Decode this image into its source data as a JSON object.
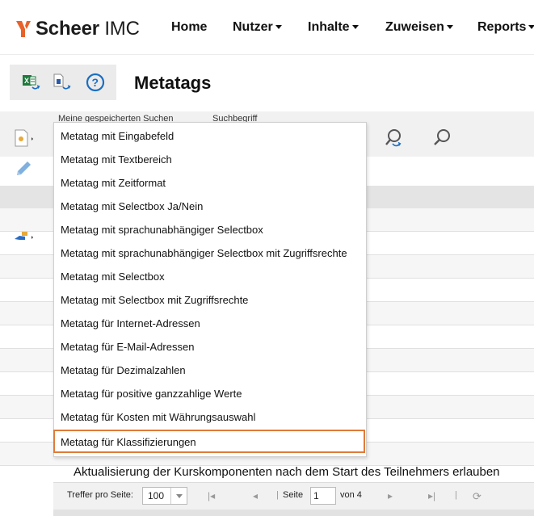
{
  "app": {
    "logo_text_bold": "Scheer",
    "logo_text_rest": " IMC",
    "brand_color": "#e8622a"
  },
  "nav": {
    "items": [
      {
        "label": "Home",
        "dropdown": false
      },
      {
        "label": "Nutzer",
        "dropdown": true
      },
      {
        "label": "Inhalte",
        "dropdown": true
      },
      {
        "label": "Zuweisen",
        "dropdown": true
      },
      {
        "label": "Reports",
        "dropdown": true
      }
    ]
  },
  "header": {
    "title": "Metatags",
    "icons": [
      "excel-export-icon",
      "document-export-icon",
      "help-icon"
    ]
  },
  "search": {
    "saved_searches_label": "Meine gespeicherten Suchen",
    "search_term_label": "Suchbegriff"
  },
  "toolbar": {
    "icons": [
      "new-document-icon",
      "edit-icon",
      "delete-icon",
      "assign-icon",
      "edit-permissions-icon"
    ]
  },
  "menu": {
    "items": [
      "Metatag mit Eingabefeld",
      "Metatag mit Textbereich",
      "Metatag mit Zeitformat",
      "Metatag mit Selectbox Ja/Nein",
      "Metatag mit sprachunabhängiger Selectbox",
      "Metatag mit sprachunabhängiger Selectbox mit Zugriffsrechte",
      "Metatag mit Selectbox",
      "Metatag mit Selectbox mit Zugriffsrechte",
      "Metatag für Internet-Adressen",
      "Metatag für E-Mail-Adressen",
      "Metatag für Dezimalzahlen",
      "Metatag für positive ganzzahlige Werte",
      "Metatag für Kosten mit Währungsauswahl",
      "Metatag für Klassifizierungen"
    ],
    "selected_index": 13,
    "highlight_color": "#e07b39"
  },
  "table": {
    "visible_row_text": "Aktualisierung der Kurskomponenten nach dem Start des Teilnehmers erlauben"
  },
  "pager": {
    "per_page_label": "Treffer pro Seite:",
    "per_page_value": "100",
    "page_label": "Seite",
    "page_value": "1",
    "of_label": "von 4"
  }
}
